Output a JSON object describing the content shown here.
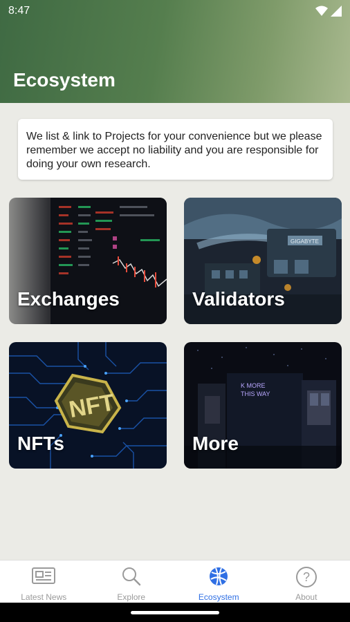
{
  "status_bar": {
    "time": "8:47"
  },
  "header": {
    "title": "Ecosystem"
  },
  "disclaimer": {
    "text": "We list & link to Projects for your convenience but we please remember we accept no liability and you are responsible for doing your own research."
  },
  "tiles": [
    {
      "label": "Exchanges"
    },
    {
      "label": "Validators"
    },
    {
      "label": "NFTs",
      "badge": "NFT"
    },
    {
      "label": "More",
      "sign": "K MORE THIS WAY"
    }
  ],
  "nav": {
    "items": [
      {
        "label": "Latest News",
        "icon": "newspaper-icon"
      },
      {
        "label": "Explore",
        "icon": "search-icon"
      },
      {
        "label": "Ecosystem",
        "icon": "globe-icon",
        "active": true
      },
      {
        "label": "About",
        "icon": "question-circle-icon"
      }
    ],
    "active_color": "#2f6fe4",
    "inactive_color": "#9a9a9a"
  },
  "theme": {
    "header_gradient_start": "#3f6a43",
    "header_gradient_end": "#a9b98f",
    "background": "#ebebe6"
  }
}
